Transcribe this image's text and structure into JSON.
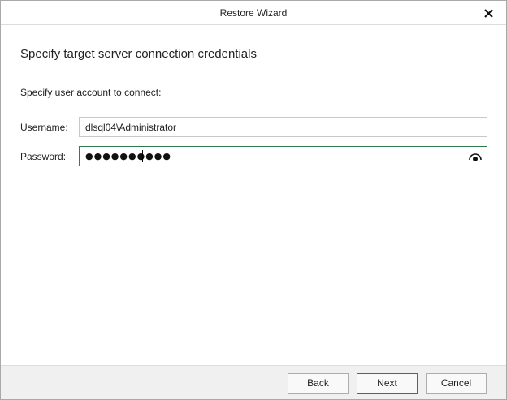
{
  "window": {
    "title": "Restore Wizard"
  },
  "page": {
    "heading": "Specify target server connection credentials",
    "subheading": "Specify user account to connect:"
  },
  "form": {
    "username_label": "Username:",
    "username_value": "dlsql04\\Administrator",
    "password_label": "Password:",
    "password_masked": "●●●●●●●●●●"
  },
  "footer": {
    "back_label": "Back",
    "next_label": "Next",
    "cancel_label": "Cancel"
  },
  "icons": {
    "close": "close-icon",
    "show_password": "eye-icon"
  },
  "colors": {
    "focus_border": "#2e7d4f"
  }
}
